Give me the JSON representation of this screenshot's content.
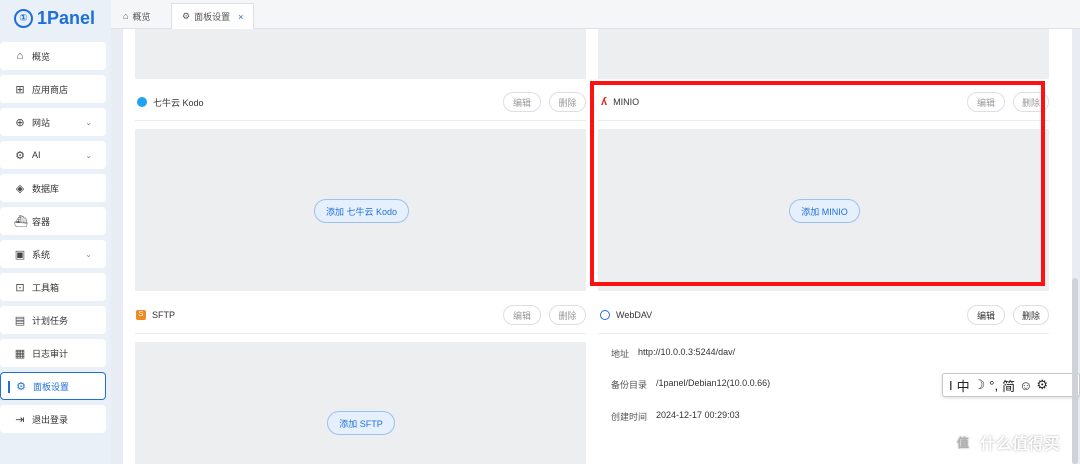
{
  "app": {
    "name": "1Panel",
    "logo_mark": "①"
  },
  "sidebar": {
    "items": [
      {
        "label": "概览",
        "icon": "home-icon",
        "glyph": "⌂"
      },
      {
        "label": "应用商店",
        "icon": "grid-icon",
        "glyph": "⊞"
      },
      {
        "label": "网站",
        "icon": "globe-icon",
        "glyph": "⊕",
        "chevron": "⌄"
      },
      {
        "label": "AI",
        "icon": "robot-icon",
        "glyph": "⚙",
        "chevron": "⌄"
      },
      {
        "label": "数据库",
        "icon": "layers-icon",
        "glyph": "◈"
      },
      {
        "label": "容器",
        "icon": "docker-icon",
        "glyph": "⛴"
      },
      {
        "label": "系统",
        "icon": "system-icon",
        "glyph": "▣",
        "chevron": "⌄"
      },
      {
        "label": "工具箱",
        "icon": "toolbox-icon",
        "glyph": "⊡"
      },
      {
        "label": "计划任务",
        "icon": "schedule-icon",
        "glyph": "▤"
      },
      {
        "label": "日志审计",
        "icon": "log-icon",
        "glyph": "▦"
      },
      {
        "label": "面板设置",
        "icon": "settings-icon",
        "glyph": "⚙"
      },
      {
        "label": "退出登录",
        "icon": "logout-icon",
        "glyph": "⇥"
      }
    ]
  },
  "tabs": [
    {
      "label": "概览",
      "glyph": "⌂"
    },
    {
      "label": "面板设置",
      "glyph": "⚙",
      "close": "×"
    }
  ],
  "cards": {
    "qiniu": {
      "title": "七牛云 Kodo",
      "edit": "编辑",
      "delete": "删除",
      "add": "添加 七牛云 Kodo"
    },
    "minio": {
      "title": "MINIO",
      "edit": "编辑",
      "delete": "删除",
      "add": "添加 MINIO"
    },
    "sftp": {
      "title": "SFTP",
      "edit": "编辑",
      "delete": "删除",
      "add": "添加 SFTP"
    },
    "webdav": {
      "title": "WebDAV",
      "edit": "编辑",
      "delete": "删除",
      "address_label": "地址",
      "address": "http://10.0.0.3:5244/dav/",
      "dir_label": "备份目录",
      "dir": "/1panel/Debian12(10.0.0.66)",
      "created_label": "创建时间",
      "created": "2024-12-17 00:29:03"
    }
  },
  "ime": {
    "items": [
      "I",
      "中",
      "☽",
      "°,",
      "简",
      "☺",
      "⚙"
    ]
  },
  "watermark": {
    "icon": "值",
    "text": "什么值得买"
  },
  "colors": {
    "accent": "#1f6fdb",
    "highlight": "#ff1111"
  }
}
